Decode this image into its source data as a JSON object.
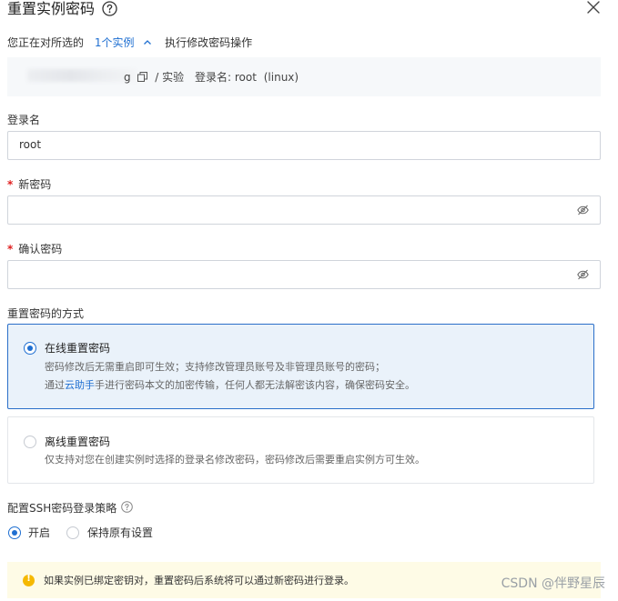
{
  "dialog": {
    "title": "重置实例密码",
    "help_icon": "question-circle-icon",
    "close_icon": "close-icon"
  },
  "selection": {
    "prefix": "您正在对所选的",
    "count_link": "1个实例",
    "chevron_icon": "chevron-up-icon",
    "suffix": "执行修改密码操作"
  },
  "instance": {
    "id_tail": "g",
    "copy_icon": "copy-icon",
    "name": "/ 实验",
    "login_label": "登录名:",
    "login_value": "root",
    "os": "(linux)"
  },
  "form": {
    "login": {
      "label": "登录名",
      "value": "root"
    },
    "new_password": {
      "label": "新密码",
      "required_mark": "*",
      "value": "",
      "icon": "eye-off-icon"
    },
    "confirm_password": {
      "label": "确认密码",
      "required_mark": "*",
      "value": "",
      "icon": "eye-off-icon"
    }
  },
  "reset_method": {
    "label": "重置密码的方式",
    "options": [
      {
        "title": "在线重置密码",
        "selected": true,
        "desc_line1": "密码修改后无需重启即可生效；支持修改管理员账号及非管理员账号的密码；",
        "desc_line2_pre": "通过",
        "desc_line2_link": "云助手",
        "desc_line2_post": "手进行密码本文的加密传输，任何人都无法解密该内容，确保密码安全。"
      },
      {
        "title": "离线重置密码",
        "selected": false,
        "desc_line1": "仅支持对您在创建实例时选择的登录名修改密码，密码修改后需要重启实例方可生效。"
      }
    ]
  },
  "ssh_policy": {
    "label": "配置SSH密码登录策略",
    "help_icon": "question-circle-icon",
    "options": [
      {
        "label": "开启",
        "selected": true
      },
      {
        "label": "保持原有设置",
        "selected": false
      }
    ]
  },
  "notice": {
    "icon": "warning-icon",
    "text": "如果实例已绑定密钥对，重置密码后系统将可以通过新密码进行登录。"
  },
  "watermark": "CSDN @伴野星辰",
  "colors": {
    "primary": "#1f6fd1",
    "required": "#e02020",
    "selected_card_bg": "#eaf2fa",
    "notice_bg": "#fefbe6",
    "warning": "#f5b800"
  }
}
